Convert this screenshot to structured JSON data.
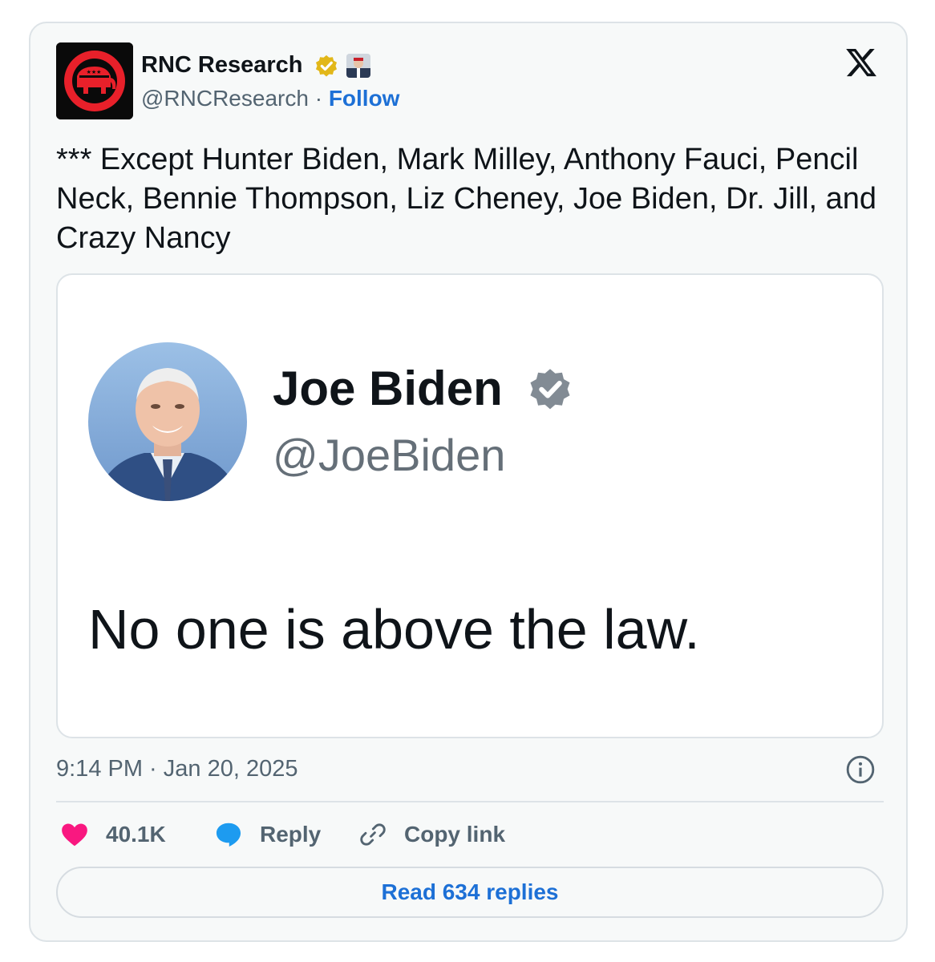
{
  "author": {
    "display_name": "RNC Research",
    "handle": "@RNCResearch",
    "separator": "·",
    "follow_label": "Follow",
    "avatar_icon": "gop-elephant-logo-icon",
    "verified_icon": "gold-verified-badge-icon",
    "affiliation_icon": "affiliation-badge-icon"
  },
  "platform_icon": "x-logo-icon",
  "tweet": {
    "text": "*** Except Hunter Biden, Mark Milley, Anthony Fauci, Pencil Neck, Bennie Thompson, Liz Cheney, Joe Biden, Dr. Jill, and Crazy Nancy"
  },
  "embedded_image": {
    "name": "Joe Biden",
    "handle": "@JoeBiden",
    "text": "No one is above the law.",
    "badge_icon": "gray-verified-badge-icon",
    "avatar_icon": "profile-photo"
  },
  "meta": {
    "timestamp": "9:14 PM · Jan 20, 2025",
    "info_icon": "info-icon"
  },
  "actions": {
    "likes": "40.1K",
    "reply_label": "Reply",
    "copy_link_label": "Copy link"
  },
  "replies_button": "Read 634 replies",
  "colors": {
    "accent": "#1d70d6",
    "heart": "#f91880",
    "reply_bubble": "#1d9bf0",
    "gold_badge": "#e2b719",
    "gop_red": "#e8202a"
  }
}
